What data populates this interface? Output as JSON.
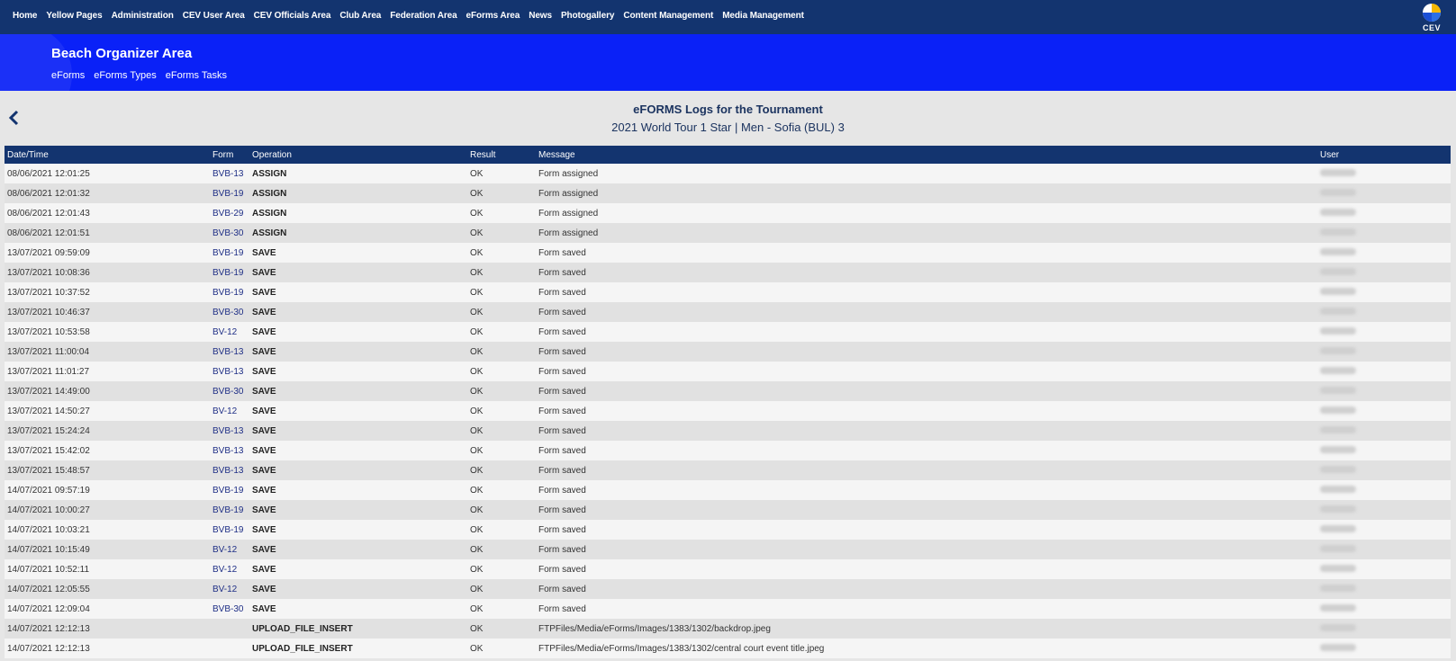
{
  "topnav": {
    "items": [
      "Home",
      "Yellow Pages",
      "Administration",
      "CEV User Area",
      "CEV Officials Area",
      "Club Area",
      "Federation Area",
      "eForms Area",
      "News",
      "Photogallery",
      "Content Management",
      "Media Management"
    ],
    "logo_text": "CEV"
  },
  "subheader": {
    "title": "Beach Organizer Area",
    "links": [
      "eForms",
      "eForms Types",
      "eForms Tasks"
    ]
  },
  "page": {
    "title": "eFORMS Logs for the Tournament",
    "subtitle": "2021 World Tour 1 Star | Men - Sofia (BUL) 3"
  },
  "table": {
    "columns": [
      "Date/Time",
      "Form",
      "Operation",
      "Result",
      "Message",
      "User"
    ],
    "rows": [
      [
        "08/06/2021 12:01:25",
        "BVB-13",
        "ASSIGN",
        "OK",
        "Form assigned"
      ],
      [
        "08/06/2021 12:01:32",
        "BVB-19",
        "ASSIGN",
        "OK",
        "Form assigned"
      ],
      [
        "08/06/2021 12:01:43",
        "BVB-29",
        "ASSIGN",
        "OK",
        "Form assigned"
      ],
      [
        "08/06/2021 12:01:51",
        "BVB-30",
        "ASSIGN",
        "OK",
        "Form assigned"
      ],
      [
        "13/07/2021 09:59:09",
        "BVB-19",
        "SAVE",
        "OK",
        "Form saved"
      ],
      [
        "13/07/2021 10:08:36",
        "BVB-19",
        "SAVE",
        "OK",
        "Form saved"
      ],
      [
        "13/07/2021 10:37:52",
        "BVB-19",
        "SAVE",
        "OK",
        "Form saved"
      ],
      [
        "13/07/2021 10:46:37",
        "BVB-30",
        "SAVE",
        "OK",
        "Form saved"
      ],
      [
        "13/07/2021 10:53:58",
        "BV-12",
        "SAVE",
        "OK",
        "Form saved"
      ],
      [
        "13/07/2021 11:00:04",
        "BVB-13",
        "SAVE",
        "OK",
        "Form saved"
      ],
      [
        "13/07/2021 11:01:27",
        "BVB-13",
        "SAVE",
        "OK",
        "Form saved"
      ],
      [
        "13/07/2021 14:49:00",
        "BVB-30",
        "SAVE",
        "OK",
        "Form saved"
      ],
      [
        "13/07/2021 14:50:27",
        "BV-12",
        "SAVE",
        "OK",
        "Form saved"
      ],
      [
        "13/07/2021 15:24:24",
        "BVB-13",
        "SAVE",
        "OK",
        "Form saved"
      ],
      [
        "13/07/2021 15:42:02",
        "BVB-13",
        "SAVE",
        "OK",
        "Form saved"
      ],
      [
        "13/07/2021 15:48:57",
        "BVB-13",
        "SAVE",
        "OK",
        "Form saved"
      ],
      [
        "14/07/2021 09:57:19",
        "BVB-19",
        "SAVE",
        "OK",
        "Form saved"
      ],
      [
        "14/07/2021 10:00:27",
        "BVB-19",
        "SAVE",
        "OK",
        "Form saved"
      ],
      [
        "14/07/2021 10:03:21",
        "BVB-19",
        "SAVE",
        "OK",
        "Form saved"
      ],
      [
        "14/07/2021 10:15:49",
        "BV-12",
        "SAVE",
        "OK",
        "Form saved"
      ],
      [
        "14/07/2021 10:52:11",
        "BV-12",
        "SAVE",
        "OK",
        "Form saved"
      ],
      [
        "14/07/2021 12:05:55",
        "BV-12",
        "SAVE",
        "OK",
        "Form saved"
      ],
      [
        "14/07/2021 12:09:04",
        "BVB-30",
        "SAVE",
        "OK",
        "Form saved"
      ],
      [
        "14/07/2021 12:12:13",
        "",
        "UPLOAD_FILE_INSERT",
        "OK",
        "FTPFiles/Media/eForms/Images/1383/1302/backdrop.jpeg"
      ],
      [
        "14/07/2021 12:12:13",
        "",
        "UPLOAD_FILE_INSERT",
        "OK",
        "FTPFiles/Media/eForms/Images/1383/1302/central court event title.jpeg"
      ]
    ]
  },
  "colors": {
    "nav_bg": "#13346f",
    "subheader_bg": "#0a21f7",
    "link": "#1f2f86"
  }
}
